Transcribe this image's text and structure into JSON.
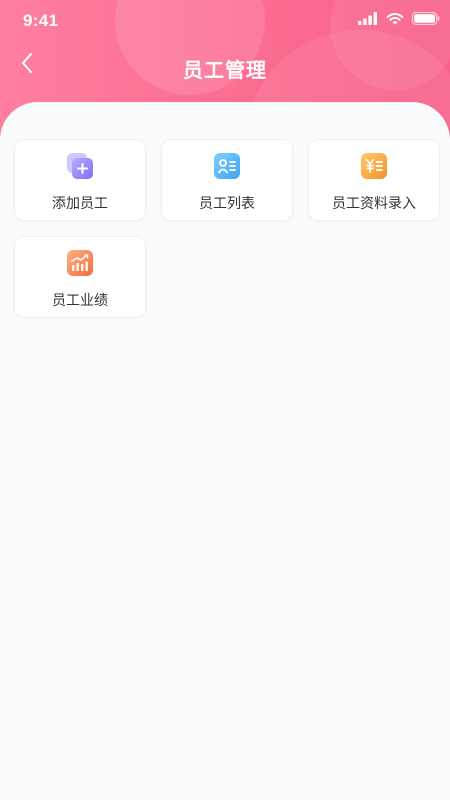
{
  "status_bar": {
    "time": "9:41"
  },
  "nav": {
    "title": "员工管理",
    "back_icon": "chevron-left-icon"
  },
  "colors": {
    "header_gradient_start": "#ff7fa0",
    "header_gradient_end": "#f8628a",
    "background": "#fafbfd",
    "card_background": "#ffffff",
    "label_text": "#333333"
  },
  "menu": [
    {
      "label": "添加员工",
      "icon": "add-user-icon",
      "color": "#8a7cf7"
    },
    {
      "label": "员工列表",
      "icon": "contact-card-icon",
      "color": "#4fb0f5"
    },
    {
      "label": "员工资料录入",
      "icon": "yuan-document-icon",
      "color": "#f9a23c"
    },
    {
      "label": "员工业绩",
      "icon": "bar-chart-icon",
      "color": "#f9784a"
    }
  ]
}
